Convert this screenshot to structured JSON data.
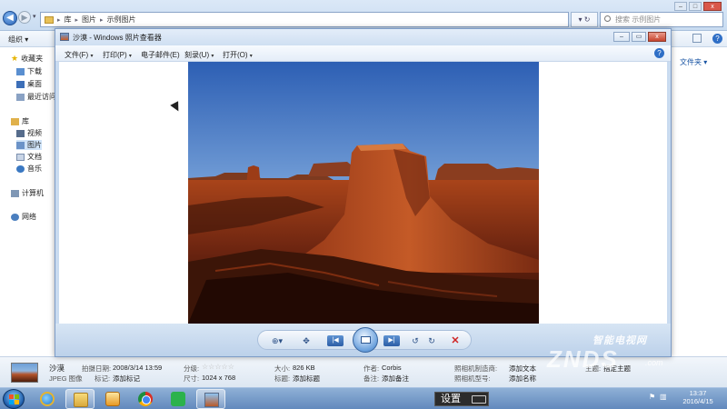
{
  "explorer": {
    "breadcrumb": [
      "库",
      "图片",
      "示例图片"
    ],
    "search_placeholder": "搜索 示例图片",
    "organize_label": "组织 ▾",
    "arrange_label": "文件夹 ▾",
    "sidebar": {
      "favorites": "收藏夹",
      "downloads": "下载",
      "desktop": "桌面",
      "recent": "最近访问的",
      "libraries": "库",
      "videos": "视频",
      "pictures": "图片",
      "documents": "文档",
      "music": "音乐",
      "computer": "计算机",
      "network": "网络"
    },
    "details": {
      "name": "沙漠",
      "type": "JPEG 图像",
      "date_taken_label": "拍摄日期:",
      "date_taken": "2008/3/14 13:59",
      "tags_label": "标记:",
      "tags_value": "添加标记",
      "rating_label": "分级:",
      "rating_stars": 0,
      "dimensions_label": "尺寸:",
      "dimensions": "1024 x 768",
      "size_label": "大小:",
      "size": "826 KB",
      "title_label": "标题:",
      "title_value": "添加标题",
      "author_label": "作者:",
      "author": "Corbis",
      "comments_label": "备注:",
      "comments_value": "添加备注",
      "camera_maker_label": "照相机制造商:",
      "camera_maker_value": "添加文本",
      "camera_model_label": "照相机型号:",
      "camera_model_value": "添加名称",
      "subject_label": "主题:",
      "subject_value": "指定主题"
    }
  },
  "viewer": {
    "title": "沙漠 - Windows 照片查看器",
    "menu": [
      "文件(F)",
      "打印(P)",
      "电子邮件(E)",
      "刻录(U)",
      "打开(O)"
    ],
    "lang_indicator": "ES"
  },
  "watermark": {
    "cn": "智能电视网",
    "en": "ZNDS",
    "com": ".com"
  },
  "taskbar": {
    "ime_label": "设置",
    "clock_time": "13:37",
    "clock_date": "2016/4/15"
  }
}
